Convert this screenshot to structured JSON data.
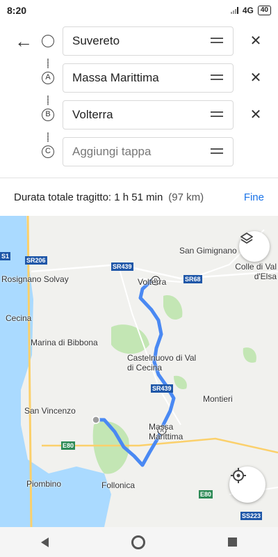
{
  "status_bar": {
    "time": "8:20",
    "network": "4G",
    "battery": "40"
  },
  "route": {
    "stops": [
      {
        "marker": "",
        "value": "Suvereto",
        "is_placeholder": false
      },
      {
        "marker": "A",
        "value": "Massa Marittima",
        "is_placeholder": false
      },
      {
        "marker": "B",
        "value": "Volterra",
        "is_placeholder": false
      },
      {
        "marker": "C",
        "value": "Aggiungi tappa",
        "is_placeholder": true
      }
    ],
    "summary_label": "Durata totale tragitto: 1 h 51 min",
    "summary_distance": "(97 km)",
    "done_label": "Fine"
  },
  "map": {
    "places": [
      "Rosignano Solvay",
      "Cecina",
      "Marina di Bibbona",
      "San Vincenzo",
      "Piombino",
      "Follonica",
      "Castelnuovo di Val di Cecina",
      "Montieri",
      "Massa Marittima",
      "Volterra",
      "San Gimignano",
      "Colle di Val d'Elsa"
    ],
    "roads": [
      "SR206",
      "SR439",
      "SR68",
      "SR439",
      "E80",
      "E80",
      "SS223",
      "S1"
    ],
    "route_color": "#4a89f3",
    "sea_color": "#aadaff",
    "park_color": "#c3e6b4"
  }
}
